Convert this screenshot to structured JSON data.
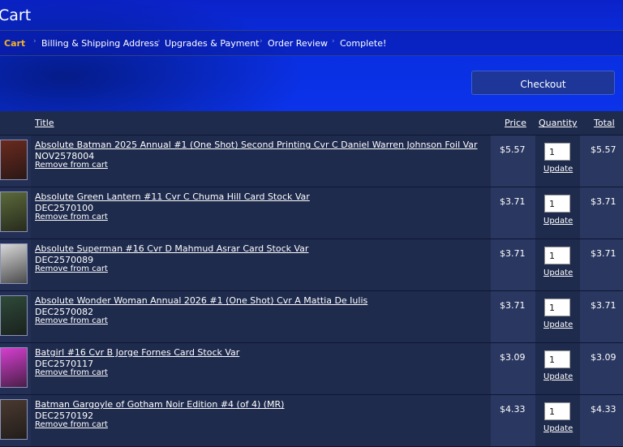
{
  "page": {
    "title": "Cart"
  },
  "steps": [
    {
      "label": "Cart"
    },
    {
      "label": "Billing & Shipping Address"
    },
    {
      "label": "Upgrades & Payment"
    },
    {
      "label": "Order Review"
    },
    {
      "label": "Complete!"
    }
  ],
  "checkout_label": "Checkout",
  "table": {
    "headers": {
      "title": "Title",
      "price": "Price",
      "quantity": "Quantity",
      "total": "Total"
    },
    "remove_label": "Remove from cart",
    "update_label": "Update",
    "rows": [
      {
        "title": "Absolute Batman 2025 Annual #1 (One Shot) Second Printing Cvr C Daniel Warren Johnson Foil Var",
        "sku": "NOV2578004",
        "price": "$5.57",
        "qty": "1",
        "total": "$5.57",
        "thumb_color": "#6a2a1e"
      },
      {
        "title": "Absolute Green Lantern #11 Cvr C Chuma Hill Card Stock Var",
        "sku": "DEC2570100",
        "price": "$3.71",
        "qty": "1",
        "total": "$3.71",
        "thumb_color": "#5c6a3a"
      },
      {
        "title": "Absolute Superman #16 Cvr D Mahmud Asrar Card Stock Var",
        "sku": "DEC2570089",
        "price": "$3.71",
        "qty": "1",
        "total": "$3.71",
        "thumb_color": "#d9d9d9"
      },
      {
        "title": "Absolute Wonder Woman Annual 2026 #1 (One Shot) Cvr A Mattia De Iulis",
        "sku": "DEC2570082",
        "price": "$3.71",
        "qty": "1",
        "total": "$3.71",
        "thumb_color": "#2f4a3a"
      },
      {
        "title": "Batgirl #16 Cvr B Jorge Fornes Card Stock Var",
        "sku": "DEC2570117",
        "price": "$3.09",
        "qty": "1",
        "total": "$3.09",
        "thumb_color": "#d63fd0"
      },
      {
        "title": "Batman Gargoyle of Gotham Noir Edition #4 (of 4) (MR)",
        "sku": "DEC2570192",
        "price": "$4.33",
        "qty": "1",
        "total": "$4.33",
        "thumb_color": "#4a3a30"
      }
    ]
  }
}
